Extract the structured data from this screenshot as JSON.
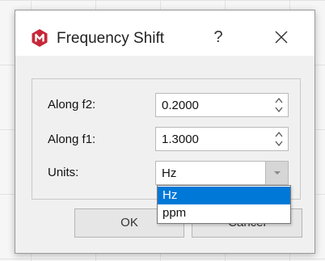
{
  "dialog": {
    "title": "Frequency Shift",
    "help_label": "?",
    "icons": {
      "app": "mnova-app-icon",
      "close": "close-icon"
    },
    "accent_color": "#0078d7",
    "app_icon_color": "#c6283a"
  },
  "form": {
    "f2": {
      "label": "Along f2:",
      "value": "0.2000"
    },
    "f1": {
      "label": "Along f1:",
      "value": "1.3000"
    },
    "units": {
      "label": "Units:",
      "value": "Hz",
      "options": [
        "Hz",
        "ppm"
      ]
    }
  },
  "buttons": {
    "ok": "OK",
    "cancel": "Cancel"
  }
}
